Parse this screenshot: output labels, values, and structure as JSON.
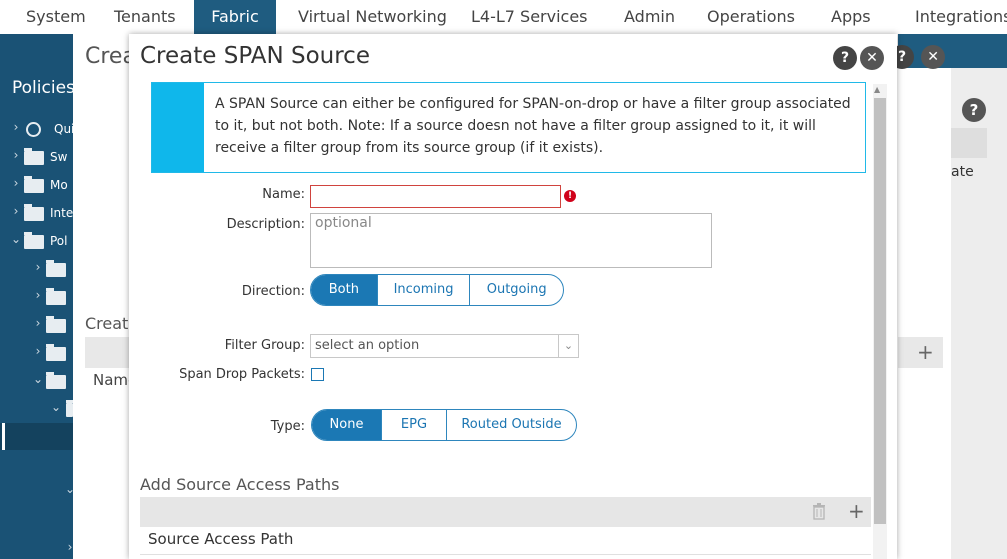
{
  "topnav": {
    "items": [
      "System",
      "Tenants",
      "Fabric",
      "Virtual Networking",
      "L4-L7 Services",
      "Admin",
      "Operations",
      "Apps",
      "Integrations"
    ],
    "active_index": 2
  },
  "background": {
    "sidebar_title": "Policies",
    "tree": [
      "Qui",
      "Sw",
      "Mo",
      "Inte",
      "Pol"
    ],
    "page_title": "Crea",
    "create_label": "Creat",
    "name_col": "Name",
    "right_label": "ate"
  },
  "modal": {
    "title": "Create SPAN Source",
    "info": "A SPAN Source can either be configured for SPAN-on-drop or have a filter group associated to it, but not both. Note: If a source doesn not have a filter group assigned to it, it will receive a filter group from its source group (if it exists).",
    "name_label": "Name:",
    "name_value": "",
    "description_label": "Description:",
    "description_placeholder": "optional",
    "direction_label": "Direction:",
    "direction_options": [
      "Both",
      "Incoming",
      "Outgoing"
    ],
    "direction_selected": "Both",
    "filter_group_label": "Filter Group:",
    "filter_group_value": "select an option",
    "span_drop_label": "Span Drop Packets:",
    "span_drop_checked": false,
    "type_label": "Type:",
    "type_options": [
      "None",
      "EPG",
      "Routed Outside"
    ],
    "type_selected": "None",
    "paths_section": "Add Source Access Paths",
    "paths_column": "Source Access Path"
  },
  "colors": {
    "nav_active": "#1f5c80",
    "sidebar": "#1a5275",
    "accent": "#1b78b4",
    "info_stripe": "#0fb7eb",
    "error": "#d0021b"
  }
}
